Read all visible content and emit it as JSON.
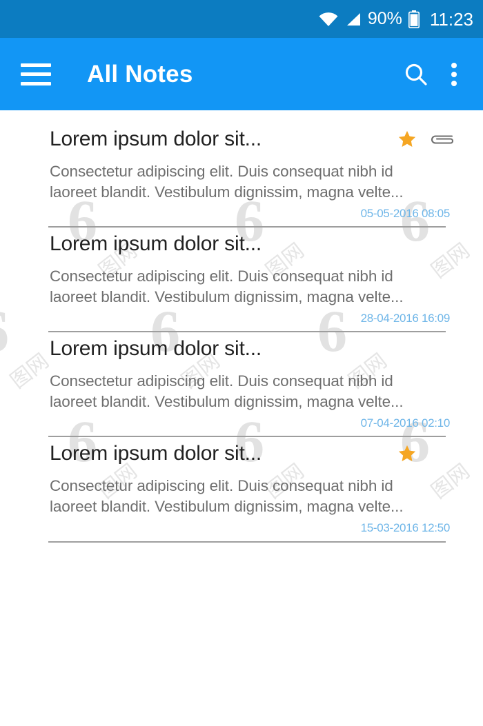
{
  "status_bar": {
    "background": "#0C7CC1",
    "wifi_icon": "wifi-icon",
    "signal_icon": "signal-bars-icon",
    "battery_percent": "90%",
    "battery_icon": "battery-icon",
    "clock": "11:23"
  },
  "app_bar": {
    "background": "#1296F5",
    "menu_icon": "hamburger-menu-icon",
    "title": "All Notes",
    "search_icon": "search-icon",
    "overflow_icon": "overflow-menu-icon"
  },
  "colors": {
    "accent": "#1296F5",
    "status_bar": "#0C7CC1",
    "star": "#F5A623",
    "date_text": "#6FB6E8",
    "title_text": "#212121",
    "body_text": "#6E6E6E",
    "divider": "#9E9E9E"
  },
  "notes": [
    {
      "title": "Lorem ipsum dolor sit...",
      "body_line1": "Consectetur adipiscing elit. Duis consequat nibh id",
      "body_line2": "laoreet blandit. Vestibulum dignissim, magna velte...",
      "date": "05-05-2016 08:05",
      "starred": true,
      "has_attachment": true
    },
    {
      "title": "Lorem ipsum dolor sit...",
      "body_line1": "Consectetur adipiscing elit. Duis consequat nibh id",
      "body_line2": "laoreet blandit. Vestibulum dignissim, magna velte...",
      "date": "28-04-2016 16:09",
      "starred": false,
      "has_attachment": false
    },
    {
      "title": "Lorem ipsum dolor sit...",
      "body_line1": "Consectetur adipiscing elit. Duis consequat nibh id",
      "body_line2": "laoreet blandit. Vestibulum dignissim, magna velte...",
      "date": "07-04-2016 02:10",
      "starred": false,
      "has_attachment": false
    },
    {
      "title": "Lorem ipsum dolor sit...",
      "body_line1": "Consectetur adipiscing elit. Duis consequat nibh id",
      "body_line2": "laoreet blandit. Vestibulum dignissim, magna velte...",
      "date": "15-03-2016 12:50",
      "starred": true,
      "has_attachment": false
    }
  ],
  "watermark": {
    "glyph": "6",
    "text": "图网"
  }
}
